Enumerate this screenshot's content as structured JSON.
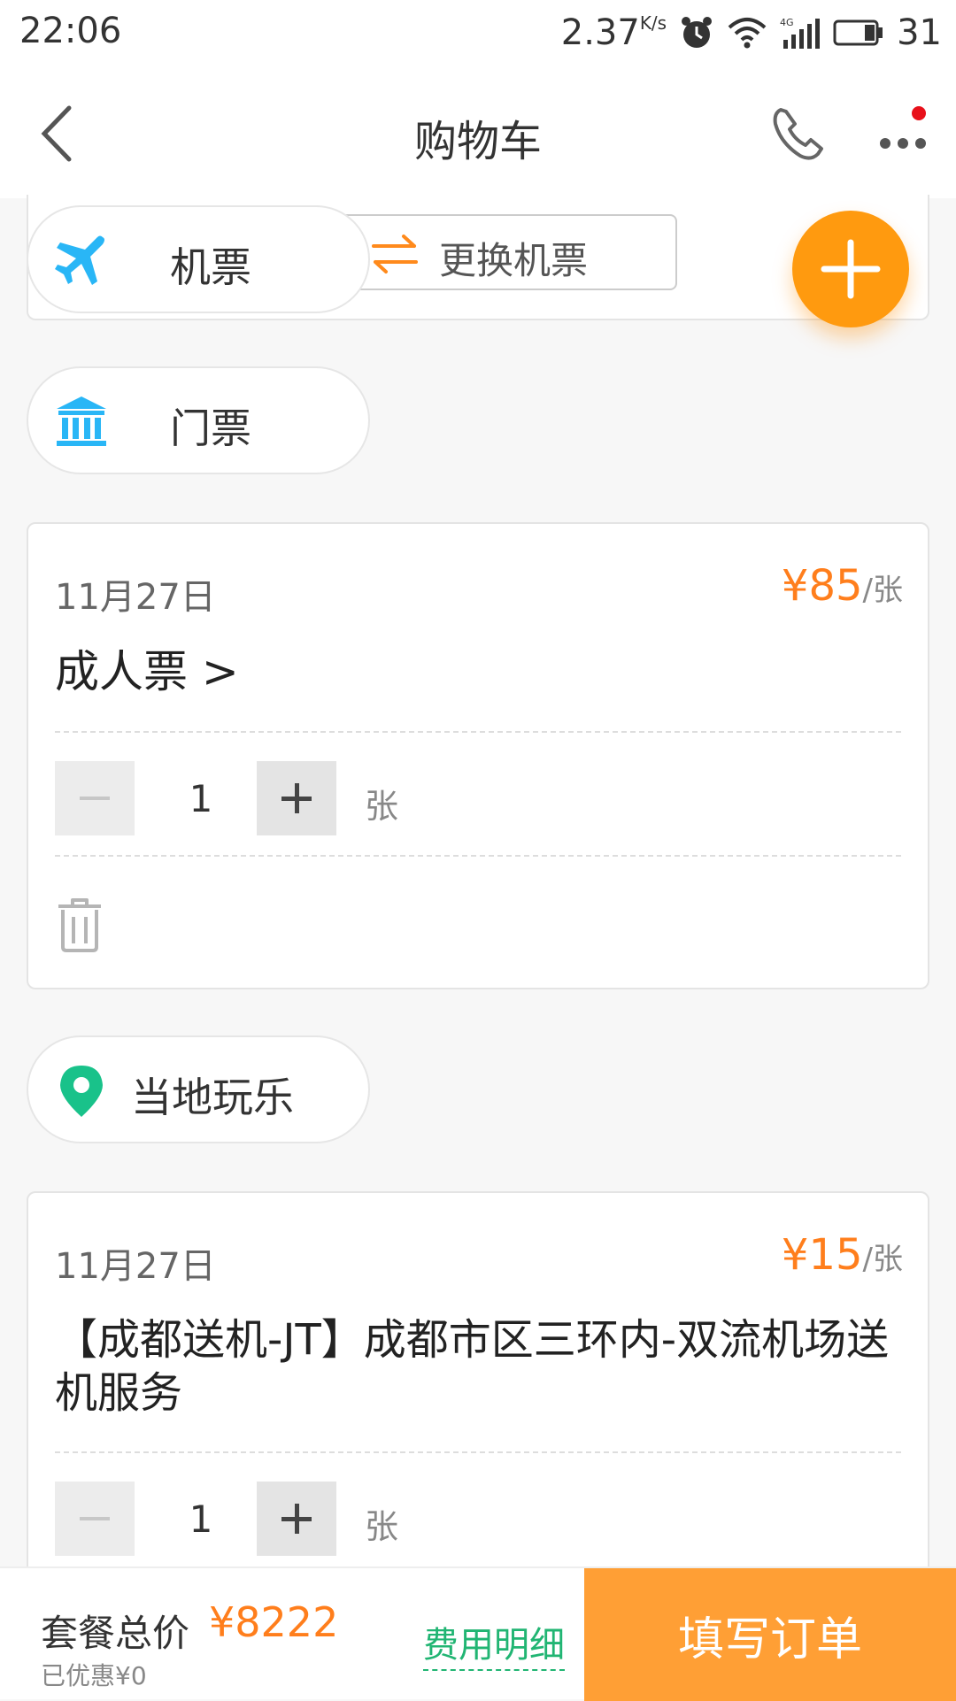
{
  "status_bar": {
    "time": "22:06",
    "speed": "2.37",
    "speed_unit": "K/s",
    "battery": "31"
  },
  "header": {
    "title": "购物车"
  },
  "sections": {
    "flight": {
      "label": "机票",
      "change_label": "更换机票"
    },
    "ticket": {
      "label": "门票"
    },
    "local": {
      "label": "当地玩乐"
    }
  },
  "ticket_item": {
    "date": "11月27日",
    "price": "¥85",
    "price_unit": "/张",
    "name": "成人票 >",
    "quantity": "1",
    "quantity_unit": "张"
  },
  "local_item": {
    "date": "11月27日",
    "price": "¥15",
    "price_unit": "/张",
    "name": "【成都送机-JT】成都市区三环内-双流机场送机服务",
    "quantity": "1",
    "quantity_unit": "张"
  },
  "bottom_bar": {
    "total_label": "套餐总价",
    "total": "¥8222",
    "saved": "已优惠¥0",
    "detail_link": "费用明细",
    "submit_label": "填写订单"
  },
  "colors": {
    "accent_orange": "#ff7e1c",
    "fab_orange": "#ff9a0f",
    "submit_orange": "#ff9f35",
    "detail_green": "#21b573",
    "icon_blue": "#29b6f6",
    "location_green": "#19c28a"
  },
  "icons": [
    "back-arrow-icon",
    "phone-icon",
    "more-icon",
    "plane-icon",
    "swap-icon",
    "plus-icon",
    "museum-icon",
    "trash-icon",
    "location-pin-icon"
  ]
}
